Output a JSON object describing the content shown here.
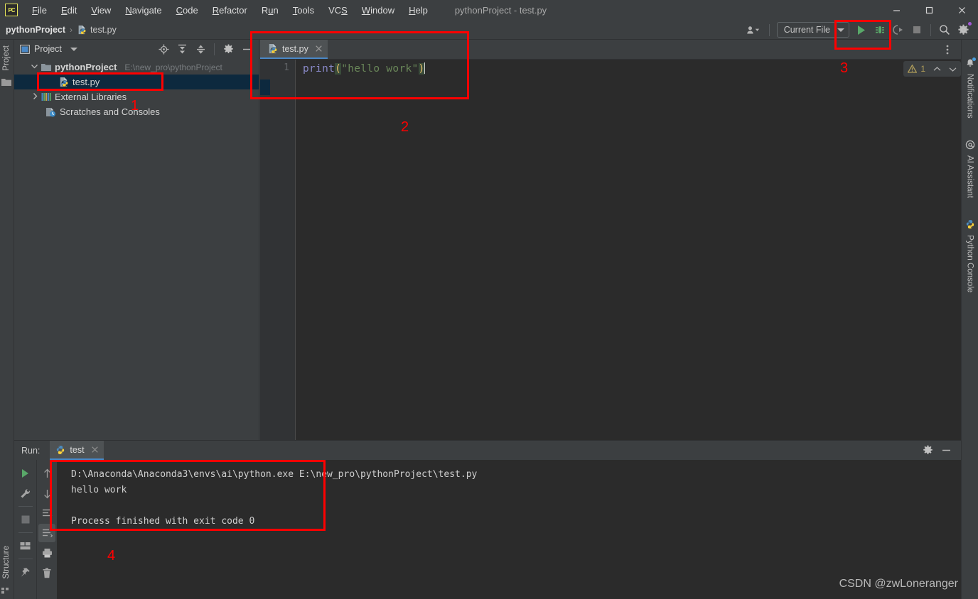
{
  "window": {
    "app_icon": "pycharm-logo-icon",
    "title": "pythonProject - test.py",
    "minimize": "minimize-icon",
    "maximize": "maximize-icon",
    "close": "close-icon"
  },
  "menu": [
    {
      "label": "File"
    },
    {
      "label": "Edit"
    },
    {
      "label": "View"
    },
    {
      "label": "Navigate"
    },
    {
      "label": "Code"
    },
    {
      "label": "Refactor"
    },
    {
      "label": "Run"
    },
    {
      "label": "Tools"
    },
    {
      "label": "VCS"
    },
    {
      "label": "Window"
    },
    {
      "label": "Help"
    }
  ],
  "breadcrumb": {
    "project": "pythonProject",
    "separator": "›",
    "file": "test.py"
  },
  "toolbar": {
    "profile_icon": "user-profile-icon",
    "run_config_label": "Current File",
    "run_config_caret": "chevron-down-icon",
    "run_icon": "run-play-icon",
    "debug_icon": "debug-bug-icon",
    "coverage_icon": "run-coverage-icon",
    "stop_icon": "stop-square-icon",
    "search_icon": "search-icon",
    "settings_icon": "gear-icon"
  },
  "left_strip": {
    "project_tab": "Project",
    "project_tab_icon": "folder-icon",
    "structure_tab": "Structure",
    "structure_tab_icon": "structure-icon"
  },
  "project_panel": {
    "title": "Project",
    "title_icon": "project-window-icon",
    "title_caret": "chevron-down-icon",
    "actions": [
      {
        "name": "locate-icon"
      },
      {
        "name": "expand-all-icon"
      },
      {
        "name": "collapse-all-icon"
      },
      {
        "name": "gear-icon"
      },
      {
        "name": "hide-icon"
      }
    ],
    "tree": [
      {
        "label": "pythonProject",
        "path": "E:\\new_pro\\pythonProject",
        "icon": "folder-icon",
        "twisty": "expanded",
        "bold": true,
        "indent": 0,
        "selected": false
      },
      {
        "label": "test.py",
        "path": "",
        "icon": "python-file-icon",
        "twisty": "none",
        "bold": false,
        "indent": 1,
        "selected": true
      },
      {
        "label": "External Libraries",
        "path": "",
        "icon": "libraries-icon",
        "twisty": "collapsed",
        "bold": false,
        "indent": 0,
        "selected": false
      },
      {
        "label": "Scratches and Consoles",
        "path": "",
        "icon": "scratches-icon",
        "twisty": "none",
        "bold": false,
        "indent": 0,
        "selected": false
      }
    ]
  },
  "editor": {
    "tab_label": "test.py",
    "tab_icon": "python-file-icon",
    "tab_close": "close-icon",
    "more_icon": "more-vertical-icon",
    "line_number": "1",
    "code": {
      "fn": "print",
      "open_paren": "(",
      "string": "\"hello work\"",
      "close_paren": ")"
    },
    "inspection": {
      "warn_icon": "warning-triangle-icon",
      "count": "1",
      "prev_icon": "chevron-up-icon",
      "next_icon": "chevron-down-icon"
    }
  },
  "right_strip": {
    "tabs": [
      {
        "label": "Notifications",
        "icon": "bell-icon"
      },
      {
        "label": "AI Assistant",
        "icon": "at-icon"
      },
      {
        "label": "Python Console",
        "icon": "python-icon"
      }
    ]
  },
  "run_panel": {
    "label": "Run:",
    "tab_label": "test",
    "tab_icon": "python-icon",
    "tab_close": "close-icon",
    "settings_icon": "gear-icon",
    "hide_icon": "hide-icon",
    "toolbar_left": [
      {
        "name": "rerun-play-icon"
      },
      {
        "name": "wrench-icon"
      },
      {
        "name": "stop-square-icon"
      },
      {
        "name": "layout-icon"
      },
      {
        "name": "pin-icon"
      }
    ],
    "toolbar_right": [
      {
        "name": "arrow-up-icon"
      },
      {
        "name": "arrow-down-icon"
      },
      {
        "name": "soft-wrap-icon"
      },
      {
        "name": "scroll-to-end-icon"
      },
      {
        "name": "print-icon"
      },
      {
        "name": "trash-icon"
      }
    ],
    "console_lines": [
      "D:\\Anaconda\\Anaconda3\\envs\\ai\\python.exe E:\\new_pro\\pythonProject\\test.py",
      "hello work",
      "",
      "Process finished with exit code 0"
    ]
  },
  "annotations": {
    "color": "#ff0000",
    "numbers": [
      {
        "label": "1"
      },
      {
        "label": "2"
      },
      {
        "label": "3"
      },
      {
        "label": "4"
      }
    ]
  },
  "watermark": "CSDN @zwLoneranger"
}
